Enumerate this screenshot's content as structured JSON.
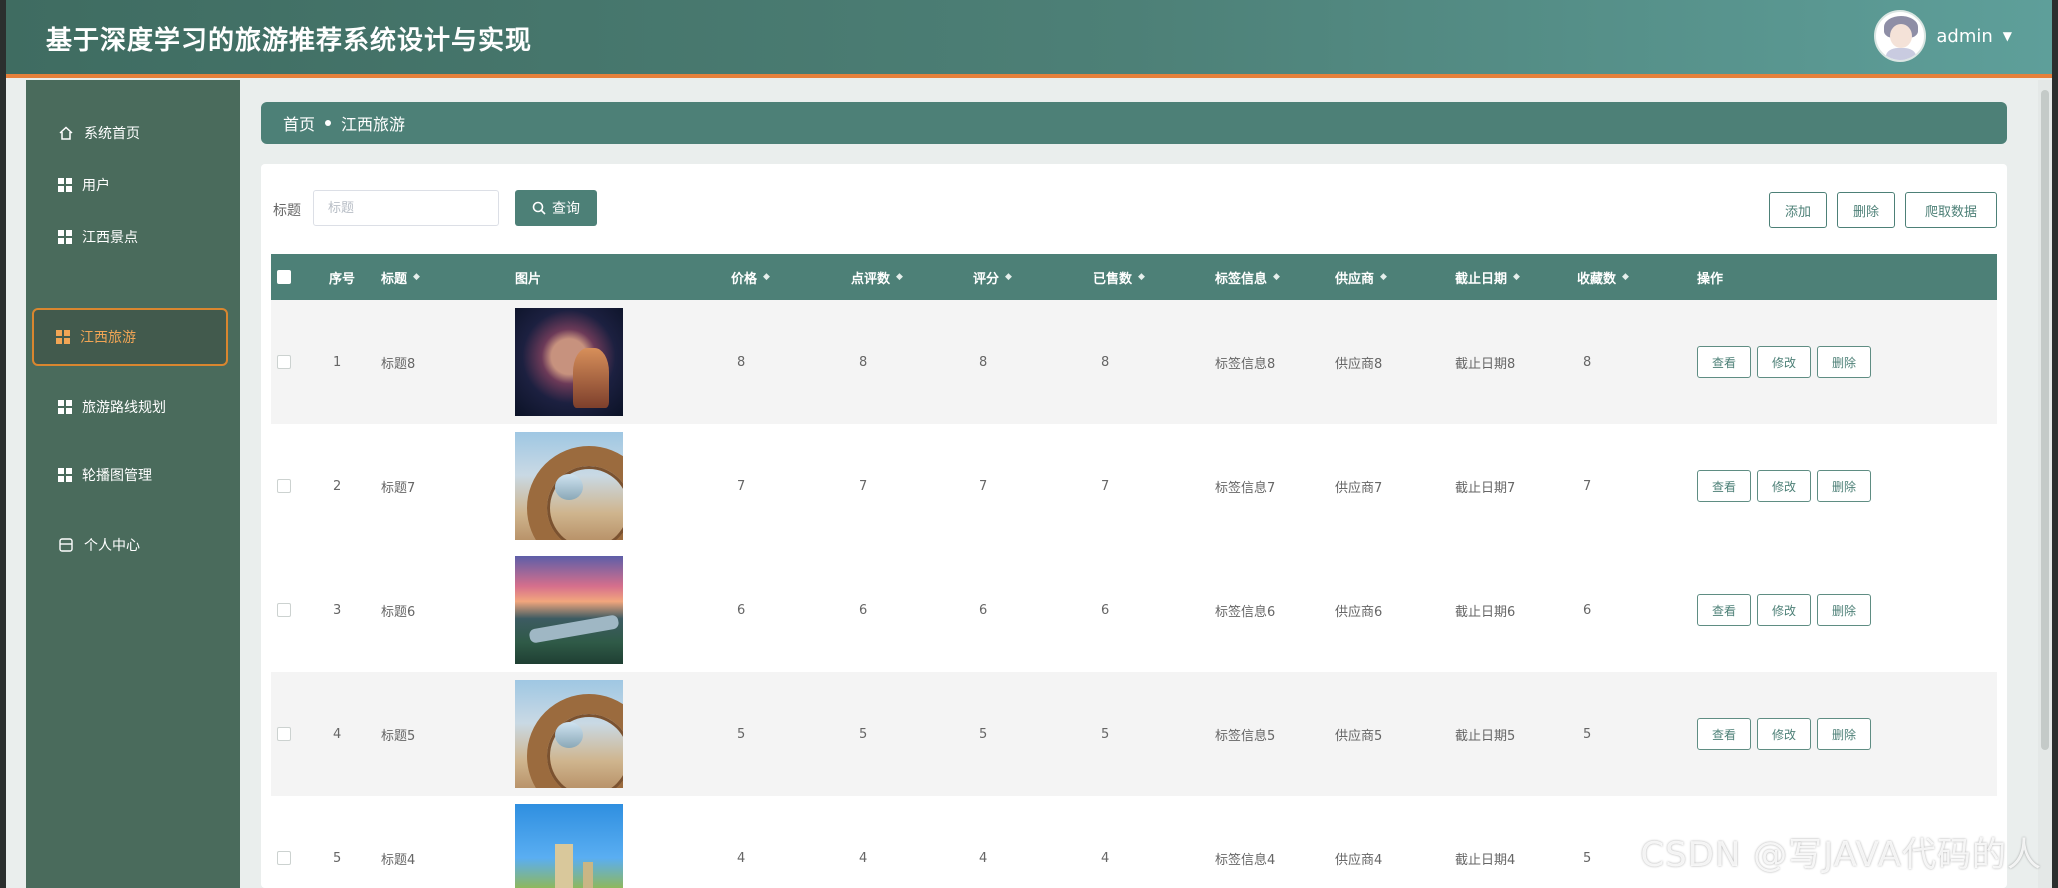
{
  "header": {
    "title": "基于深度学习的旅游推荐系统设计与实现",
    "user_name": "admin",
    "caret": "▼"
  },
  "sidebar": {
    "items": [
      {
        "label": "系统首页",
        "icon": "home-icon"
      },
      {
        "label": "用户",
        "icon": "grid-icon"
      },
      {
        "label": "江西景点",
        "icon": "grid-icon"
      },
      {
        "label": "江西旅游",
        "icon": "grid-icon",
        "active": true
      },
      {
        "label": "旅游路线规划",
        "icon": "grid-icon"
      },
      {
        "label": "轮播图管理",
        "icon": "grid-icon"
      },
      {
        "label": "个人中心",
        "icon": "person-icon"
      }
    ]
  },
  "breadcrumb": {
    "home": "首页",
    "current": "江西旅游"
  },
  "search": {
    "label": "标题",
    "placeholder": "标题",
    "value": "",
    "button_label": "查询"
  },
  "actions": {
    "add": "添加",
    "delete": "删除",
    "crawl": "爬取数据"
  },
  "table": {
    "columns": {
      "index": "序号",
      "title": "标题",
      "image": "图片",
      "price": "价格",
      "likes": "点评数",
      "rating": "评分",
      "sold": "已售数",
      "tags": "标签信息",
      "supplier": "供应商",
      "deadline": "截止日期",
      "favorites": "收藏数",
      "ops": "操作"
    },
    "row_ops": {
      "view": "查看",
      "edit": "修改",
      "delete": "删除"
    },
    "rows": [
      {
        "index": "1",
        "title": "标题8",
        "price": "8",
        "likes": "8",
        "rating": "8",
        "sold": "8",
        "tags": "标签信息8",
        "supplier": "供应商8",
        "deadline": "截止日期8",
        "favorites": "8",
        "image": "night-lantern-photo"
      },
      {
        "index": "2",
        "title": "标题7",
        "price": "7",
        "likes": "7",
        "rating": "7",
        "sold": "7",
        "tags": "标签信息7",
        "supplier": "供应商7",
        "deadline": "截止日期7",
        "favorites": "7",
        "image": "straw-nest-photo"
      },
      {
        "index": "3",
        "title": "标题6",
        "price": "6",
        "likes": "6",
        "rating": "6",
        "sold": "6",
        "tags": "标签信息6",
        "supplier": "供应商6",
        "deadline": "截止日期6",
        "favorites": "6",
        "image": "river-sunset-photo"
      },
      {
        "index": "4",
        "title": "标题5",
        "price": "5",
        "likes": "5",
        "rating": "5",
        "sold": "5",
        "tags": "标签信息5",
        "supplier": "供应商5",
        "deadline": "截止日期5",
        "favorites": "5",
        "image": "straw-nest-photo"
      },
      {
        "index": "5",
        "title": "标题4",
        "price": "4",
        "likes": "4",
        "rating": "4",
        "sold": "4",
        "tags": "标签信息4",
        "supplier": "供应商4",
        "deadline": "截止日期4",
        "favorites": "5",
        "image": "city-tower-photo"
      }
    ]
  },
  "watermark": "CSDN @写JAVA代码的人",
  "colors": {
    "primary": "#4d8077",
    "sidebar": "#4a6b5c",
    "accent": "#e6803b",
    "active_text": "#f1a555"
  }
}
